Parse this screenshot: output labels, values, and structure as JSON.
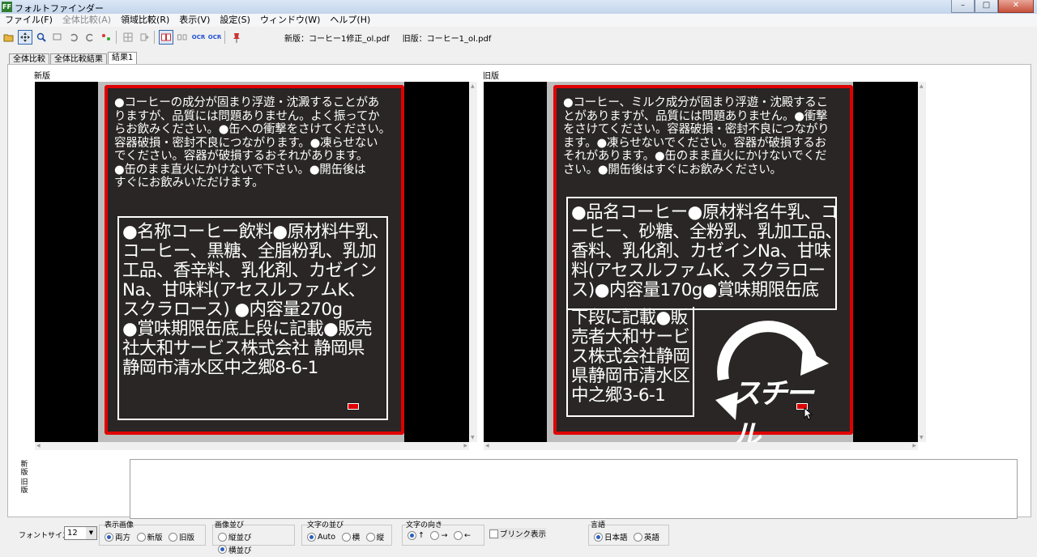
{
  "window": {
    "title": "フォルトファインダー",
    "app_icon_text": "FF",
    "controls": [
      "–",
      "□",
      "✕"
    ]
  },
  "menubar": [
    {
      "label": "ファイル(F)",
      "enabled": true
    },
    {
      "label": "全体比較(A)",
      "enabled": false
    },
    {
      "label": "領域比較(R)",
      "enabled": true
    },
    {
      "label": "表示(V)",
      "enabled": true
    },
    {
      "label": "設定(S)",
      "enabled": true
    },
    {
      "label": "ウィンドウ(W)",
      "enabled": true
    },
    {
      "label": "ヘルプ(H)",
      "enabled": true
    }
  ],
  "toolbar": {
    "ocr1": "OCR",
    "ocr2": "OCR",
    "new_file": "新版：コーヒー1修正_ol.pdf",
    "old_file": "旧版：コーヒー1_ol.pdf"
  },
  "tabs": [
    {
      "label": "全体比較",
      "active": false
    },
    {
      "label": "全体比較結果",
      "active": false
    },
    {
      "label": "結果1",
      "active": true
    }
  ],
  "panels": {
    "new_label": "新版",
    "old_label": "旧版"
  },
  "new_label_text": {
    "warning": "●コーヒーの成分が固まり浮遊・沈澱することがあ\nりますが、品質には問題ありません。よく振ってか\nらお飲みください。●缶への衝撃をさけてください。\n容器破損・密封不良につながります。●凍らせない\nでください。容器が破損するおそれがあります。\n●缶のまま直火にかけないで下さい。●開缶後は\nすぐにお飲みいただけます。",
    "ingredients": "●名称コーヒー飲料●原材料牛乳、\nコーヒー、黒糖、全脂粉乳、乳加\n工品、香辛料、乳化剤、カゼイン\nNa、甘味料(アセスルファムK、\nスクラロース) ●内容量270g\n●賞味期限缶底上段に記載●販売\n社大和サービス株式会社 静岡県\n静岡市清水区中之郷8-6-1"
  },
  "old_label_text": {
    "warning": "●コーヒー、ミルク成分が固まり浮遊・沈殿するこ\nとがありますが、品質には問題ありません。●衝撃\nをさけてください。容器破損・密封不良につながり\nます。●凍らせないでください。容器が破損するお\nそれがあります。●缶のまま直火にかけないでくだ\nさい。●開缶後はすぐにお飲みください。",
    "ingredients": "●品名コーヒー●原材料名牛乳、コ\nーヒー、砂糖、全粉乳、乳加工品、\n香料、乳化剤、カゼインNa、甘味\n料(アセスルファムK、スクラロー\nス)●内容量170g●賞味期限缶底",
    "seller": "下段に記載●販\n売者大和サービ\nス株式会社静岡\n県静岡市清水区\n中之郷3-6-1",
    "recycle_text": "スチール"
  },
  "text_area": {
    "new_label": "新\n版",
    "old_label": "旧\n版",
    "content": ""
  },
  "bottom": {
    "font_size_label": "フォントサイズ",
    "font_size_value": "12",
    "display_image": {
      "title": "表示画像",
      "options": [
        "両方",
        "新版",
        "旧版"
      ],
      "selected": 0
    },
    "image_arrange": {
      "title": "画像並び",
      "options": [
        "縦並び",
        "横並び"
      ],
      "selected": 1
    },
    "char_arrange": {
      "title": "文字の並び",
      "options": [
        "Auto",
        "横",
        "縦"
      ],
      "selected": 0
    },
    "char_direction": {
      "title": "文字の向き",
      "options": [
        "↑",
        "→",
        "←"
      ],
      "selected": 0
    },
    "blink": "ブリンク表示",
    "language": {
      "title": "言語",
      "options": [
        "日本語",
        "英語"
      ],
      "selected": 0
    }
  },
  "colors": {
    "highlight": "#e00000",
    "label_bg": "#2a2626",
    "accent": "#2a5fbf"
  }
}
